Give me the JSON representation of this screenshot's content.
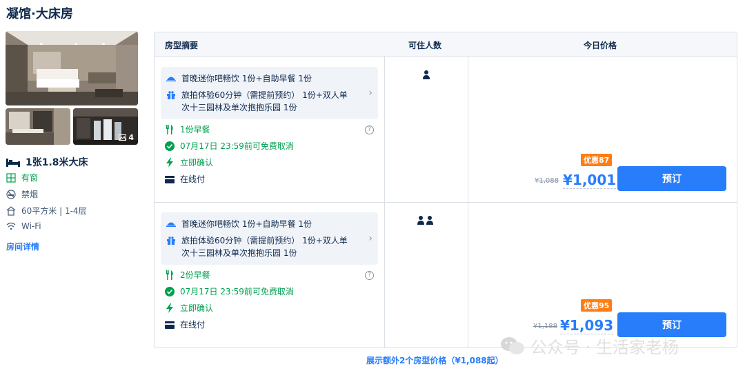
{
  "page_title": "凝馆·大床房",
  "photos": {
    "count": "4"
  },
  "room": {
    "bed": "1张1.8米大床",
    "facilities": [
      {
        "icon": "window-icon",
        "label": "有窗"
      },
      {
        "icon": "no-smoking-icon",
        "label": "禁烟"
      },
      {
        "icon": "area-icon",
        "label": "60平方米 | 1-4层"
      },
      {
        "icon": "wifi-icon",
        "label": "Wi-Fi"
      }
    ],
    "detail_link": "房间详情"
  },
  "table": {
    "headers": [
      "房型摘要",
      "可住人数",
      "今日价格"
    ]
  },
  "offers": [
    {
      "package_line1": "首晚迷你吧畅饮 1份+自助早餐 1份",
      "package_line2a": "旅拍体验60分钟（需提前预约） 1份+双人单",
      "package_line2b": "次十三园林及单次抱抱乐园 1份",
      "breakfast": "1份早餐",
      "cancel": "07月17日 23:59前可免费取消",
      "confirm": "立即确认",
      "payment": "在线付",
      "guests": 1,
      "discount": "优惠87",
      "old_price": "¥1,088",
      "price": "¥1,001",
      "book": "预订"
    },
    {
      "package_line1": "首晚迷你吧畅饮 1份+自助早餐 1份",
      "package_line2a": "旅拍体验60分钟（需提前预约） 1份+双人单",
      "package_line2b": "次十三园林及单次抱抱乐园 1份",
      "breakfast": "2份早餐",
      "cancel": "07月17日 23:59前可免费取消",
      "confirm": "立即确认",
      "payment": "在线付",
      "guests": 2,
      "discount": "优惠95",
      "old_price": "¥1,188",
      "price": "¥1,093",
      "book": "预订"
    }
  ],
  "more_link": "展示额外2个房型价格（¥1,088起）",
  "watermark": "公众号 · 生活家老杨",
  "colors": {
    "accent": "#287dfa",
    "green": "#00a04f",
    "orange": "#ff7d13",
    "text": "#0f294d"
  }
}
